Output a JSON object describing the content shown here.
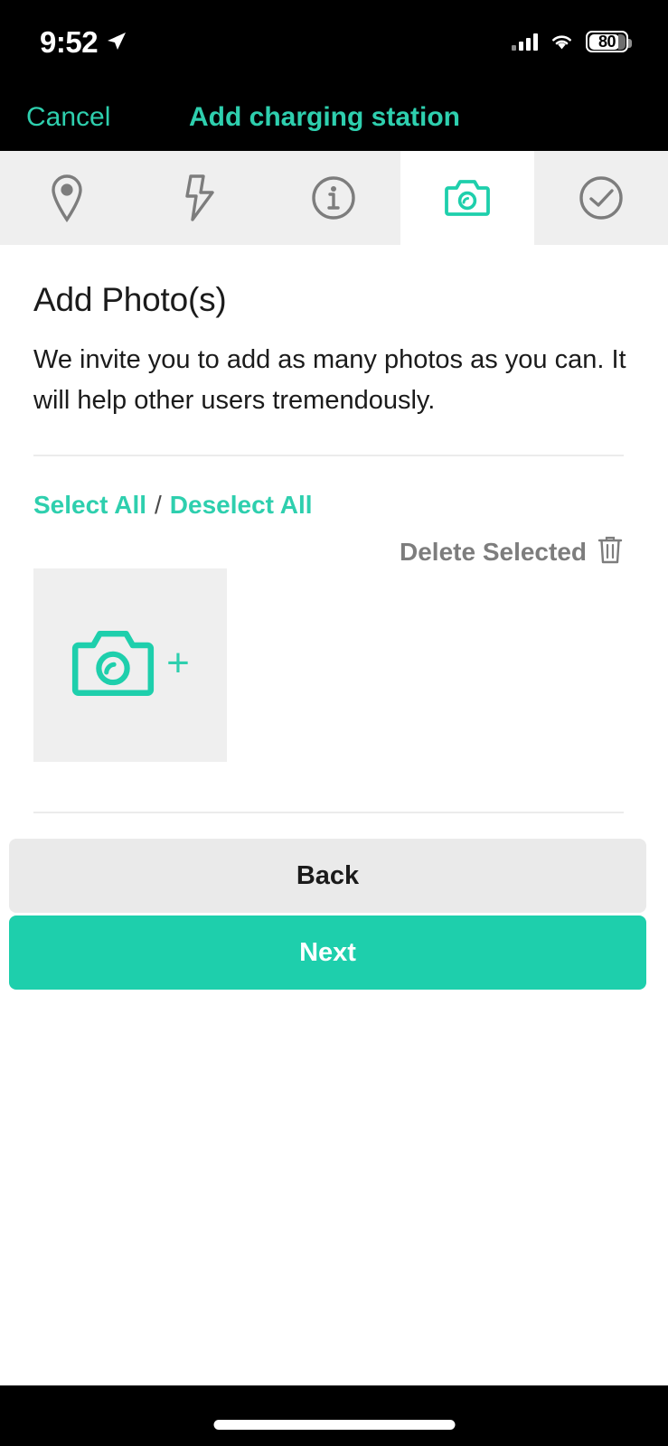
{
  "status_bar": {
    "time": "9:52",
    "location_icon": "location-arrow-icon",
    "signal_icon": "cellular-signal-icon",
    "wifi_icon": "wifi-icon",
    "battery_icon": "battery-icon",
    "battery_level": "80"
  },
  "nav": {
    "cancel_label": "Cancel",
    "title": "Add charging station"
  },
  "tabs": [
    {
      "name": "location",
      "icon": "map-pin-icon",
      "active": false
    },
    {
      "name": "power",
      "icon": "lightning-bolt-icon",
      "active": false
    },
    {
      "name": "info",
      "icon": "info-circle-icon",
      "active": false
    },
    {
      "name": "photos",
      "icon": "camera-icon",
      "active": true
    },
    {
      "name": "confirm",
      "icon": "check-circle-icon",
      "active": false
    }
  ],
  "main": {
    "heading": "Add Photo(s)",
    "description": "We invite you to add as many photos as you can. It will help other users tremendously.",
    "select_all_label": "Select All",
    "separator": "/",
    "deselect_all_label": "Deselect All",
    "delete_selected_label": "Delete Selected",
    "delete_icon": "trash-icon",
    "add_photo_icon": "camera-icon",
    "add_photo_plus": "+"
  },
  "footer": {
    "back_label": "Back",
    "next_label": "Next"
  },
  "colors": {
    "accent": "#2ecfae",
    "next_button": "#1ecfac",
    "back_button": "#eaeaea",
    "tile_background": "#efefef",
    "tab_inactive_background": "#efefef",
    "tab_icon_gray": "#7d7d7d",
    "text_primary": "#1b1b1b",
    "text_muted": "#7d7d7d",
    "divider": "#ececec",
    "bar_background": "#000000"
  }
}
